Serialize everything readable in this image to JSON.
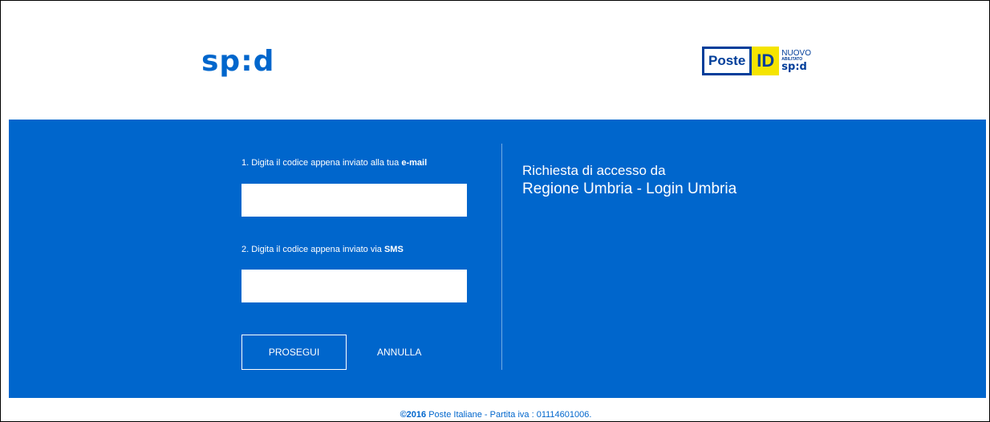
{
  "header": {
    "spid_logo_text": "sp:d",
    "poste_logo": {
      "brand": "Poste",
      "id": "ID",
      "nuovo": "NUOVO",
      "abilitato": "ABILITATO",
      "spid": "sp:d"
    }
  },
  "form": {
    "email_label_prefix": "1. Digita il codice appena inviato alla tua ",
    "email_label_bold": "e-mail",
    "email_value": "",
    "sms_label_prefix": "2. Digita il codice appena inviato via ",
    "sms_label_bold": "SMS",
    "sms_value": "",
    "prosegui_label": "PROSEGUI",
    "annulla_label": "ANNULLA"
  },
  "request": {
    "line1": "Richiesta di accesso da",
    "line2": "Regione Umbria - Login Umbria"
  },
  "footer": {
    "year": "©2016",
    "text": " Poste Italiane - Partita iva : 01114601006."
  },
  "colors": {
    "primary_blue": "#0066cc",
    "poste_blue": "#003e9a",
    "poste_yellow": "#f5e400"
  }
}
